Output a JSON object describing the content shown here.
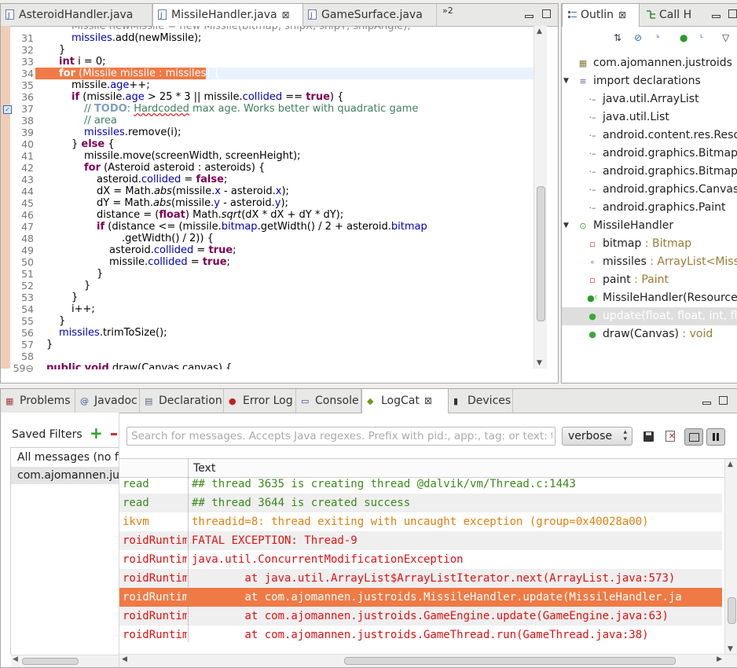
{
  "editor": {
    "tabs": [
      {
        "label": "AsteroidHandler.java"
      },
      {
        "label": "MissileHandler.java",
        "active": true,
        "close": "⊠"
      },
      {
        "label": "GameSurface.java"
      }
    ],
    "overflow": "»2",
    "lines": [
      {
        "n": "31"
      },
      {
        "n": "32"
      },
      {
        "n": "33"
      },
      {
        "n": "34"
      },
      {
        "n": "35"
      },
      {
        "n": "36"
      },
      {
        "n": "37"
      },
      {
        "n": "38"
      },
      {
        "n": "39"
      },
      {
        "n": "40"
      },
      {
        "n": "41"
      },
      {
        "n": "42"
      },
      {
        "n": "43"
      },
      {
        "n": "44"
      },
      {
        "n": "45"
      },
      {
        "n": "46"
      },
      {
        "n": "47"
      },
      {
        "n": "48"
      },
      {
        "n": "49"
      },
      {
        "n": "50"
      },
      {
        "n": "51"
      },
      {
        "n": "52"
      },
      {
        "n": "53"
      },
      {
        "n": "54"
      },
      {
        "n": "55"
      },
      {
        "n": "56"
      },
      {
        "n": "57"
      },
      {
        "n": "58"
      },
      {
        "n": "59⊖"
      }
    ]
  },
  "outline": {
    "tabs": [
      {
        "label": "Outlin",
        "close": "⊠"
      },
      {
        "label": "Call H"
      }
    ],
    "items": [
      {
        "icon": "▦",
        "iconColor": "#8a7a3a",
        "name": "com.ajomannen.justroids",
        "type": "",
        "indent": 18
      },
      {
        "icon": "≡",
        "iconColor": "#5a6a9a",
        "name": "import declarations",
        "type": "",
        "indent": 18,
        "twisty": "▼"
      },
      {
        "icon": "·–",
        "iconColor": "#4a5a8a",
        "name": "java.util.ArrayList",
        "type": "",
        "indent": 30
      },
      {
        "icon": "·–",
        "iconColor": "#4a5a8a",
        "name": "java.util.List",
        "type": "",
        "indent": 30
      },
      {
        "icon": "·–",
        "iconColor": "#4a5a8a",
        "name": "android.content.res.Resou",
        "type": "",
        "indent": 30
      },
      {
        "icon": "·–",
        "iconColor": "#4a5a8a",
        "name": "android.graphics.Bitmap",
        "type": "",
        "indent": 30
      },
      {
        "icon": "·–",
        "iconColor": "#4a5a8a",
        "name": "android.graphics.BitmapF",
        "type": "",
        "indent": 30
      },
      {
        "icon": "·–",
        "iconColor": "#4a5a8a",
        "name": "android.graphics.Canvas",
        "type": "",
        "indent": 30
      },
      {
        "icon": "·–",
        "iconColor": "#4a5a8a",
        "name": "android.graphics.Paint",
        "type": "",
        "indent": 30
      },
      {
        "icon": "⊙",
        "iconColor": "#3a9a3a",
        "name": "MissileHandler",
        "type": "",
        "indent": 18,
        "twisty": "▼"
      },
      {
        "icon": "▫",
        "iconColor": "#c03030",
        "name": "bitmap",
        "type": " : Bitmap",
        "indent": 30
      },
      {
        "icon": "∘",
        "iconColor": "#3a9a3a",
        "name": "missiles",
        "type": " : ArrayList<Missil",
        "indent": 30
      },
      {
        "icon": "▫",
        "iconColor": "#c03030",
        "name": "paint",
        "type": " : Paint",
        "indent": 30
      },
      {
        "icon": "●ᶜ",
        "iconColor": "#2a9a2a",
        "name": "MissileHandler(Resources",
        "type": "",
        "indent": 30
      },
      {
        "icon": "●",
        "iconColor": "#3aaa3a",
        "name": "update(float, float, int, flo",
        "type": "",
        "indent": 30,
        "selected": true
      },
      {
        "icon": "●",
        "iconColor": "#3aaa3a",
        "name": "draw(Canvas)",
        "type": " : void",
        "indent": 30
      }
    ]
  },
  "bottom": {
    "tabs": [
      {
        "label": "Problems",
        "icon": "▦"
      },
      {
        "label": "Javadoc",
        "icon": "@"
      },
      {
        "label": "Declaration",
        "icon": "▤"
      },
      {
        "label": "Error Log",
        "icon": "●"
      },
      {
        "label": "Console",
        "icon": "▭"
      },
      {
        "label": "LogCat",
        "icon": "◆",
        "active": true,
        "close": "⊠"
      },
      {
        "label": "Devices",
        "icon": "▮"
      }
    ],
    "saved_filters_label": "Saved Filters",
    "filters": [
      {
        "label": "All messages (no fi"
      },
      {
        "label": "com.ajomannen.jus",
        "selected": true
      }
    ],
    "search_placeholder": "Search for messages. Accepts Java regexes. Prefix with pid:, app:, tag: or text: to",
    "level": "verbose",
    "text_header": "Text",
    "rows": [
      {
        "tag": "read",
        "text": "## thread 3635 is creating thread @dalvik/vm/Thread.c:1443",
        "color": "#3a8a1a"
      },
      {
        "tag": "read",
        "text": "## thread 3644 is created success",
        "color": "#3a8a1a"
      },
      {
        "tag": "ikvm",
        "text": "threadid=8: thread exiting with uncaught exception (group=0x40028a00)",
        "color": "#e08010"
      },
      {
        "tag": "roidRuntim",
        "text": "FATAL EXCEPTION: Thread-9",
        "color": "#e01010"
      },
      {
        "tag": "roidRuntim",
        "text": "java.util.ConcurrentModificationException",
        "color": "#e01010"
      },
      {
        "tag": "roidRuntim",
        "text": "        at java.util.ArrayList$ArrayListIterator.next(ArrayList.java:573)",
        "color": "#e01010"
      },
      {
        "tag": "roidRuntim",
        "text": "        at com.ajomannen.justroids.MissileHandler.update(MissileHandler.ja",
        "color": "#ffffff",
        "selected": true
      },
      {
        "tag": "roidRuntim",
        "text": "        at com.ajomannen.justroids.GameEngine.update(GameEngine.java:63)",
        "color": "#e01010"
      },
      {
        "tag": "roidRuntim",
        "text": "        at com.ajomannen.justroids.GameThread.run(GameThread.java:38)",
        "color": "#e01010"
      }
    ]
  }
}
